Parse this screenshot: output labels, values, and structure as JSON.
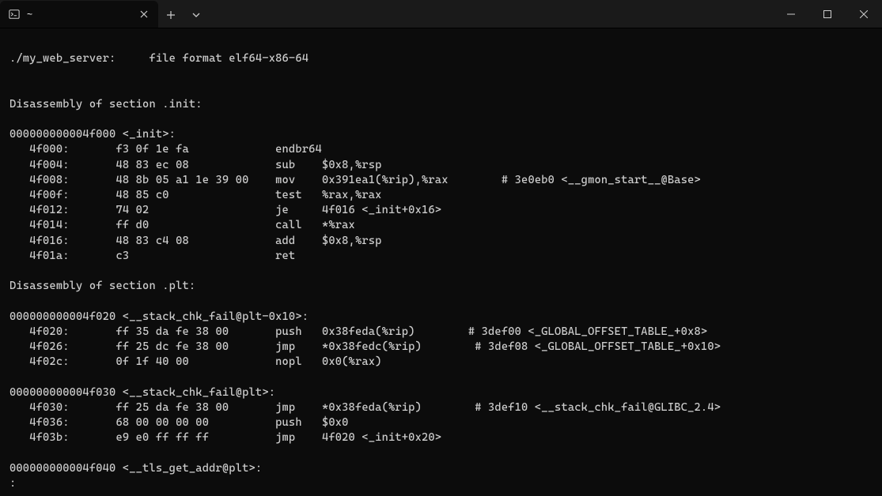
{
  "window": {
    "tab_title": "~",
    "minimize": "—",
    "maximize": "▢",
    "close": "✕"
  },
  "terminal": {
    "lines": [
      "",
      "./my_web_server:     file format elf64-x86-64",
      "",
      "",
      "Disassembly of section .init:",
      "",
      "000000000004f000 <_init>:",
      "   4f000:       f3 0f 1e fa             endbr64",
      "   4f004:       48 83 ec 08             sub    $0x8,%rsp",
      "   4f008:       48 8b 05 a1 1e 39 00    mov    0x391ea1(%rip),%rax        # 3e0eb0 <__gmon_start__@Base>",
      "   4f00f:       48 85 c0                test   %rax,%rax",
      "   4f012:       74 02                   je     4f016 <_init+0x16>",
      "   4f014:       ff d0                   call   *%rax",
      "   4f016:       48 83 c4 08             add    $0x8,%rsp",
      "   4f01a:       c3                      ret",
      "",
      "Disassembly of section .plt:",
      "",
      "000000000004f020 <__stack_chk_fail@plt-0x10>:",
      "   4f020:       ff 35 da fe 38 00       push   0x38feda(%rip)        # 3def00 <_GLOBAL_OFFSET_TABLE_+0x8>",
      "   4f026:       ff 25 dc fe 38 00       jmp    *0x38fedc(%rip)        # 3def08 <_GLOBAL_OFFSET_TABLE_+0x10>",
      "   4f02c:       0f 1f 40 00             nopl   0x0(%rax)",
      "",
      "000000000004f030 <__stack_chk_fail@plt>:",
      "   4f030:       ff 25 da fe 38 00       jmp    *0x38feda(%rip)        # 3def10 <__stack_chk_fail@GLIBC_2.4>",
      "   4f036:       68 00 00 00 00          push   $0x0",
      "   4f03b:       e9 e0 ff ff ff          jmp    4f020 <_init+0x20>",
      "",
      "000000000004f040 <__tls_get_addr@plt>:",
      ":"
    ]
  }
}
